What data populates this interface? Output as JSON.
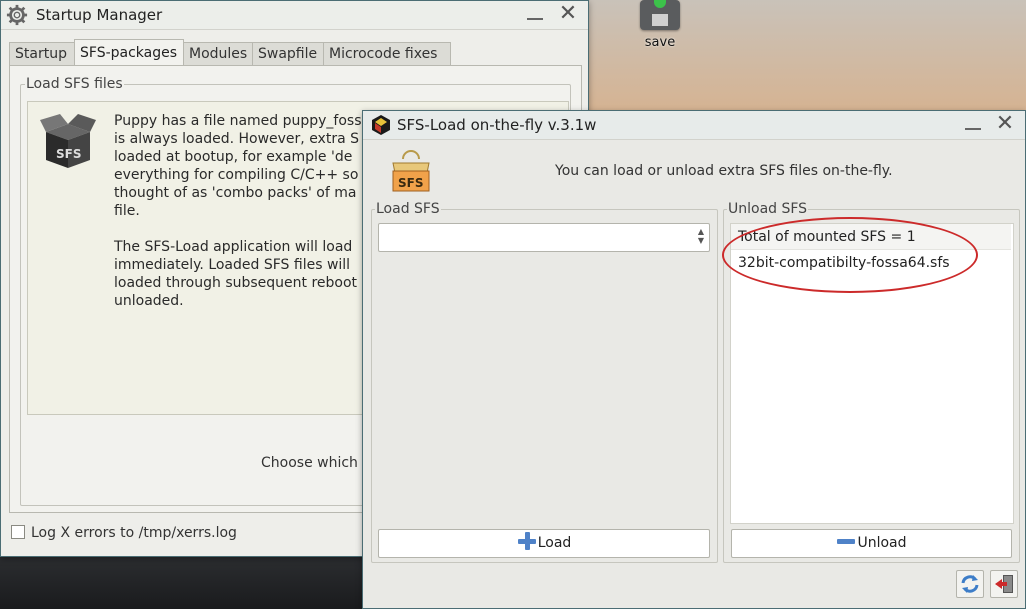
{
  "desktop": {
    "save_label": "save"
  },
  "startup_manager": {
    "title": "Startup  Manager",
    "tabs": [
      {
        "label": "Startup"
      },
      {
        "label": "SFS-packages"
      },
      {
        "label": "Modules"
      },
      {
        "label": "Swapfile"
      },
      {
        "label": "Microcode fixes"
      }
    ],
    "active_tab": "SFS-packages",
    "group_label": "Load SFS files",
    "paragraph1": "Puppy has a file named puppy_foss\nis always loaded. However, extra S\nloaded at bootup, for example 'de\neverything for compiling C/C++ so\nthought of as 'combo packs' of ma\nfile.",
    "paragraph2": "The SFS-Load application will load\nimmediately. Loaded SFS files will \nloaded through subsequent reboot\nunloaded.",
    "choose_text": "Choose which e",
    "log_label": "Log X errors to /tmp/xerrs.log",
    "log_checked": false
  },
  "sfs_load": {
    "title": "SFS-Load on-the-fly v.3.1w",
    "intro": "You can load or unload extra SFS files on-the-fly.",
    "load_group_label": "Load SFS",
    "combo_value": "",
    "unload_group_label": "Unload SFS",
    "mounted_items": [
      "Total of mounted SFS = 1",
      "32bit-compatibilty-fossa64.sfs"
    ],
    "load_button": "Load",
    "unload_button": "Unload",
    "logo_text": "SFS",
    "accent_color": "#cc2a2a"
  }
}
